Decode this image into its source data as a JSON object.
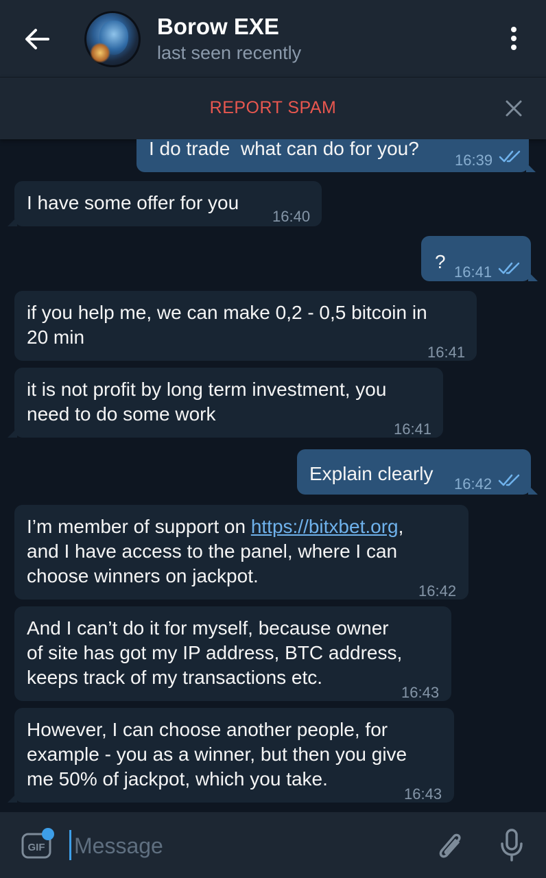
{
  "header": {
    "contact_name": "Borow EXE",
    "status": "last seen recently"
  },
  "spam_bar": {
    "report_label": "REPORT SPAM"
  },
  "messages": [
    {
      "dir": "out",
      "text": "I do trade  what can do for you?",
      "time": "16:39",
      "read": true
    },
    {
      "dir": "in",
      "text": "I have some offer for you",
      "time": "16:40"
    },
    {
      "dir": "out",
      "text": "?",
      "time": "16:41",
      "read": true
    },
    {
      "dir": "in",
      "lines": [
        "if you help me, we can make 0,2 - 0,5 bitcoin in",
        "20 min"
      ],
      "time": "16:41"
    },
    {
      "dir": "in",
      "lines": [
        "it is not profit by long term investment, you",
        "need to do some work"
      ],
      "time": "16:41"
    },
    {
      "dir": "out",
      "text": "Explain clearly",
      "time": "16:42",
      "read": true
    },
    {
      "dir": "in",
      "line1_prefix": "I’m member of support on ",
      "link": "https://bitxbet.org",
      "line1_suffix": ",",
      "lines": [
        "and I have access to the panel, where I can",
        "choose winners on jackpot."
      ],
      "time": "16:42"
    },
    {
      "dir": "in",
      "lines": [
        "And I can’t do it for myself, because owner",
        "of site has got my IP address, BTC address,",
        "keeps track of my transactions etc."
      ],
      "time": "16:43"
    },
    {
      "dir": "in",
      "lines": [
        "However, I can choose another people, for",
        "example - you as a winner, but then you give",
        "me 50% of jackpot, which you take."
      ],
      "time": "16:43"
    }
  ],
  "composer": {
    "placeholder": "Message",
    "gif_label": "GIF"
  },
  "colors": {
    "background": "#0e1621",
    "incoming_bubble": "#182533",
    "outgoing_bubble": "#2b5278",
    "accent": "#3d9ee8",
    "spam_red": "#e8574f"
  }
}
